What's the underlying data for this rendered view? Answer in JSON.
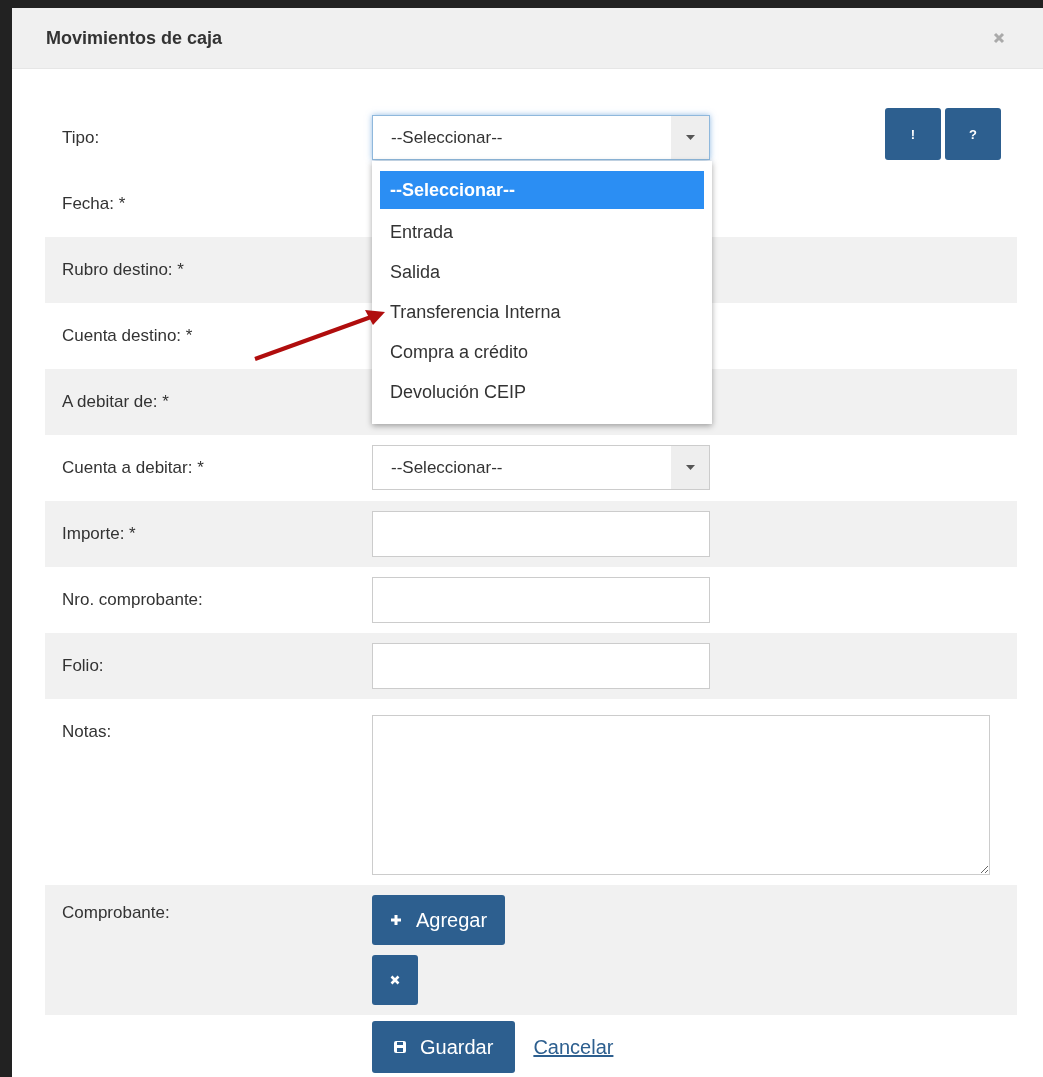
{
  "dialog": {
    "title": "Movimientos de caja"
  },
  "help_buttons": [
    "!",
    "?"
  ],
  "fields": [
    {
      "label": "Tipo:",
      "kind": "select",
      "value": "--Seleccionar--",
      "open": true
    },
    {
      "label": "Fecha: *"
    },
    {
      "label": "Rubro destino: *"
    },
    {
      "label": "Cuenta destino: *"
    },
    {
      "label": "A debitar de: *"
    },
    {
      "label": "Cuenta a debitar: *",
      "kind": "select",
      "value": "--Seleccionar--",
      "open": false
    },
    {
      "label": "Importe: *",
      "kind": "text"
    },
    {
      "label": "Nro. comprobante:",
      "kind": "text"
    },
    {
      "label": "Folio:",
      "kind": "text"
    },
    {
      "label": "Notas:",
      "kind": "textarea"
    }
  ],
  "dropdown": {
    "options": [
      {
        "label": "--Seleccionar--",
        "selected": true
      },
      {
        "label": "Entrada",
        "selected": false
      },
      {
        "label": "Salida",
        "selected": false
      },
      {
        "label": "Transferencia Interna",
        "selected": false
      },
      {
        "label": "Compra a crédito",
        "selected": false
      },
      {
        "label": "Devolución CEIP",
        "selected": false
      }
    ]
  },
  "attachment": {
    "label": "Comprobante:",
    "buttons": [
      {
        "kind": "add",
        "label": "Agregar"
      },
      {
        "kind": "remove"
      }
    ]
  },
  "footer": {
    "save": "Guardar",
    "cancel": "Cancelar"
  },
  "annotation": {
    "kind": "arrow"
  }
}
